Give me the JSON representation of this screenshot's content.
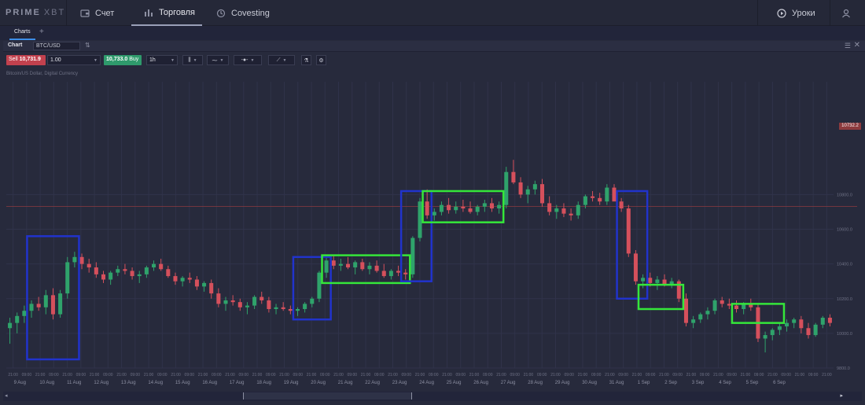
{
  "nav": {
    "logo": "PRIME",
    "logo_suffix": "XBT",
    "account": "Счет",
    "trading": "Торговля",
    "covesting": "Covesting",
    "lessons": "Уроки"
  },
  "tabs": {
    "charts": "Charts",
    "add": "+"
  },
  "chart_header": {
    "title": "Chart",
    "symbol": "BTC/USD"
  },
  "toolbar": {
    "sell_label": "Sell",
    "sell_price": "10,731.9",
    "quantity": "1.00",
    "buy_price": "10,733.0",
    "buy_label": "Buy",
    "timeframe": "1h"
  },
  "legend": "Bitcoin/US Dollar, Digital Currency",
  "current_price": "10732.2",
  "colors": {
    "background": "#272a3c",
    "up": "#2fa36b",
    "down": "#d5505c",
    "accumulation_box": "#2aa3ff",
    "distribution_box": "#35e63a",
    "impulse_box": "#2133cc"
  },
  "chart_data": {
    "type": "candlestick",
    "symbol": "BTC/USD",
    "interval": "1h",
    "ylim": [
      9800,
      11450
    ],
    "y_ticks": [
      {
        "value": 9800,
        "label": "9800.0"
      },
      {
        "value": 10000,
        "label": "10000.0"
      },
      {
        "value": 10200,
        "label": "10200.0"
      },
      {
        "value": 10400,
        "label": "10400.0"
      },
      {
        "value": 10600,
        "label": "10600.0"
      },
      {
        "value": 10800,
        "label": "10800.0"
      }
    ],
    "x_time_labels": [
      "21:00",
      "09:00",
      "21:00",
      "09:00",
      "21:00",
      "09:00",
      "21:00",
      "09:00",
      "21:00",
      "09:00",
      "21:00",
      "09:00",
      "21:00",
      "09:00",
      "21:00",
      "09:00",
      "21:00",
      "09:00",
      "21:00",
      "09:00",
      "21:00",
      "09:00",
      "21:00",
      "09:00",
      "21:00",
      "09:00",
      "21:00",
      "09:00",
      "21:00",
      "09:00",
      "21:00",
      "09:00",
      "21:00",
      "09:00",
      "21:00",
      "09:00",
      "21:00",
      "09:00",
      "21:00",
      "09:00",
      "21:00",
      "09:00",
      "21:00",
      "09:00",
      "21:00",
      "09:00",
      "21:00",
      "09:00",
      "21:00",
      "09:00",
      "21:00",
      "09:00",
      "21:00",
      "09:00",
      "21:00",
      "09:00",
      "21:00",
      "09:00",
      "21:00",
      "09:00",
      "21:00"
    ],
    "x_date_labels": [
      "9 Aug",
      "10 Aug",
      "11 Aug",
      "12 Aug",
      "13 Aug",
      "14 Aug",
      "15 Aug",
      "16 Aug",
      "17 Aug",
      "18 Aug",
      "19 Aug",
      "20 Aug",
      "21 Aug",
      "22 Aug",
      "23 Aug",
      "24 Aug",
      "25 Aug",
      "26 Aug",
      "27 Aug",
      "28 Aug",
      "29 Aug",
      "30 Aug",
      "31 Aug",
      "1 Sep",
      "2 Sep",
      "3 Sep",
      "4 Sep",
      "5 Sep",
      "6 Sep"
    ],
    "candles": [
      [
        10030,
        10090,
        9940,
        10060
      ],
      [
        10060,
        10120,
        10000,
        10100
      ],
      [
        10100,
        10160,
        10060,
        10130
      ],
      [
        10130,
        10190,
        10090,
        10170
      ],
      [
        10170,
        10210,
        10130,
        10150
      ],
      [
        10150,
        10250,
        10110,
        10220
      ],
      [
        10220,
        10260,
        10080,
        10110
      ],
      [
        10110,
        10250,
        10090,
        10230
      ],
      [
        10230,
        10440,
        10200,
        10410
      ],
      [
        10410,
        10470,
        10380,
        10440
      ],
      [
        10440,
        10460,
        10370,
        10400
      ],
      [
        10400,
        10430,
        10350,
        10380
      ],
      [
        10380,
        10410,
        10320,
        10340
      ],
      [
        10340,
        10360,
        10290,
        10310
      ],
      [
        10310,
        10360,
        10280,
        10350
      ],
      [
        10350,
        10390,
        10330,
        10370
      ],
      [
        10370,
        10400,
        10340,
        10360
      ],
      [
        10360,
        10380,
        10310,
        10330
      ],
      [
        10330,
        10360,
        10290,
        10340
      ],
      [
        10340,
        10390,
        10320,
        10380
      ],
      [
        10380,
        10420,
        10360,
        10400
      ],
      [
        10400,
        10430,
        10360,
        10370
      ],
      [
        10370,
        10390,
        10320,
        10330
      ],
      [
        10330,
        10350,
        10280,
        10300
      ],
      [
        10300,
        10330,
        10270,
        10320
      ],
      [
        10320,
        10350,
        10290,
        10310
      ],
      [
        10310,
        10330,
        10250,
        10270
      ],
      [
        10270,
        10300,
        10240,
        10290
      ],
      [
        10290,
        10310,
        10200,
        10230
      ],
      [
        10230,
        10260,
        10150,
        10170
      ],
      [
        10170,
        10210,
        10130,
        10190
      ],
      [
        10190,
        10220,
        10160,
        10180
      ],
      [
        10180,
        10200,
        10130,
        10150
      ],
      [
        10150,
        10180,
        10110,
        10160
      ],
      [
        10160,
        10220,
        10140,
        10210
      ],
      [
        10210,
        10240,
        10170,
        10190
      ],
      [
        10190,
        10210,
        10120,
        10140
      ],
      [
        10140,
        10170,
        10110,
        10150
      ],
      [
        10150,
        10180,
        10130,
        10140
      ],
      [
        10140,
        10160,
        10110,
        10130
      ],
      [
        10130,
        10150,
        10100,
        10140
      ],
      [
        10140,
        10180,
        10120,
        10170
      ],
      [
        10170,
        10210,
        10150,
        10200
      ],
      [
        10200,
        10360,
        10180,
        10350
      ],
      [
        10350,
        10440,
        10320,
        10420
      ],
      [
        10420,
        10450,
        10370,
        10390
      ],
      [
        10390,
        10430,
        10360,
        10400
      ],
      [
        10400,
        10440,
        10370,
        10380
      ],
      [
        10380,
        10420,
        10340,
        10410
      ],
      [
        10410,
        10430,
        10360,
        10370
      ],
      [
        10370,
        10410,
        10340,
        10390
      ],
      [
        10390,
        10420,
        10350,
        10360
      ],
      [
        10360,
        10400,
        10320,
        10330
      ],
      [
        10330,
        10370,
        10310,
        10360
      ],
      [
        10360,
        10390,
        10330,
        10350
      ],
      [
        10350,
        10370,
        10310,
        10340
      ],
      [
        10340,
        10560,
        10320,
        10550
      ],
      [
        10550,
        10780,
        10530,
        10760
      ],
      [
        10760,
        10830,
        10660,
        10680
      ],
      [
        10680,
        10720,
        10650,
        10700
      ],
      [
        10700,
        10760,
        10680,
        10740
      ],
      [
        10740,
        10780,
        10690,
        10710
      ],
      [
        10710,
        10760,
        10690,
        10730
      ],
      [
        10730,
        10770,
        10700,
        10720
      ],
      [
        10720,
        10760,
        10690,
        10700
      ],
      [
        10700,
        10740,
        10680,
        10730
      ],
      [
        10730,
        10770,
        10700,
        10750
      ],
      [
        10750,
        10780,
        10700,
        10720
      ],
      [
        10720,
        10760,
        10690,
        10740
      ],
      [
        10740,
        10960,
        10720,
        10930
      ],
      [
        10930,
        11000,
        10860,
        10870
      ],
      [
        10870,
        10900,
        10780,
        10800
      ],
      [
        10800,
        10850,
        10750,
        10830
      ],
      [
        10830,
        10880,
        10800,
        10860
      ],
      [
        10860,
        10890,
        10730,
        10750
      ],
      [
        10750,
        10790,
        10680,
        10700
      ],
      [
        10700,
        10740,
        10660,
        10720
      ],
      [
        10720,
        10750,
        10670,
        10690
      ],
      [
        10690,
        10720,
        10650,
        10680
      ],
      [
        10680,
        10760,
        10660,
        10740
      ],
      [
        10740,
        10800,
        10720,
        10790
      ],
      [
        10790,
        10820,
        10760,
        10780
      ],
      [
        10780,
        10810,
        10740,
        10760
      ],
      [
        10760,
        10860,
        10740,
        10840
      ],
      [
        10840,
        10860,
        10780,
        10760
      ],
      [
        10760,
        10780,
        10700,
        10720
      ],
      [
        10720,
        10740,
        10440,
        10460
      ],
      [
        10460,
        10480,
        10280,
        10300
      ],
      [
        10300,
        10340,
        10260,
        10320
      ],
      [
        10320,
        10350,
        10270,
        10290
      ],
      [
        10290,
        10330,
        10250,
        10310
      ],
      [
        10310,
        10340,
        10270,
        10280
      ],
      [
        10280,
        10320,
        10260,
        10300
      ],
      [
        10300,
        10310,
        10180,
        10200
      ],
      [
        10200,
        10230,
        10040,
        10060
      ],
      [
        10060,
        10100,
        10030,
        10080
      ],
      [
        10080,
        10120,
        10060,
        10110
      ],
      [
        10110,
        10150,
        10080,
        10130
      ],
      [
        10130,
        10200,
        10110,
        10190
      ],
      [
        10190,
        10210,
        10150,
        10170
      ],
      [
        10170,
        10200,
        10140,
        10160
      ],
      [
        10160,
        10190,
        10120,
        10140
      ],
      [
        10140,
        10180,
        10110,
        10170
      ],
      [
        10170,
        10200,
        10130,
        10150
      ],
      [
        10150,
        10170,
        9950,
        9970
      ],
      [
        9970,
        10010,
        9890,
        9990
      ],
      [
        9990,
        10030,
        9960,
        10020
      ],
      [
        10020,
        10060,
        9990,
        10040
      ],
      [
        10040,
        10080,
        10010,
        10060
      ],
      [
        10060,
        10090,
        10030,
        10080
      ],
      [
        10080,
        10100,
        10000,
        10030
      ],
      [
        10030,
        10060,
        9970,
        9990
      ],
      [
        9990,
        10060,
        9980,
        10050
      ],
      [
        10050,
        10100,
        10030,
        10090
      ],
      [
        10090,
        10110,
        10040,
        10060
      ]
    ],
    "annotations": [
      {
        "label": "impulse",
        "color": "impulse_box",
        "from_candle": 3,
        "to_candle": 9,
        "y_range": [
          9850,
          10560
        ]
      },
      {
        "label": "impulse",
        "color": "impulse_box",
        "from_candle": 40,
        "to_candle": 44,
        "y_range": [
          10080,
          10440
        ]
      },
      {
        "label": "range",
        "color": "distribution_box",
        "from_candle": 44,
        "to_candle": 55,
        "y_range": [
          10290,
          10450
        ]
      },
      {
        "label": "impulse",
        "color": "impulse_box",
        "from_candle": 55,
        "to_candle": 58,
        "y_range": [
          10300,
          10820
        ]
      },
      {
        "label": "range",
        "color": "distribution_box",
        "from_candle": 58,
        "to_candle": 68,
        "y_range": [
          10640,
          10820
        ]
      },
      {
        "label": "impulse",
        "color": "impulse_box",
        "from_candle": 85,
        "to_candle": 88,
        "y_range": [
          10200,
          10820
        ]
      },
      {
        "label": "range",
        "color": "distribution_box",
        "from_candle": 88,
        "to_candle": 93,
        "y_range": [
          10140,
          10280
        ]
      },
      {
        "label": "range",
        "color": "distribution_box",
        "from_candle": 101,
        "to_candle": 107,
        "y_range": [
          10060,
          10170
        ]
      }
    ]
  }
}
